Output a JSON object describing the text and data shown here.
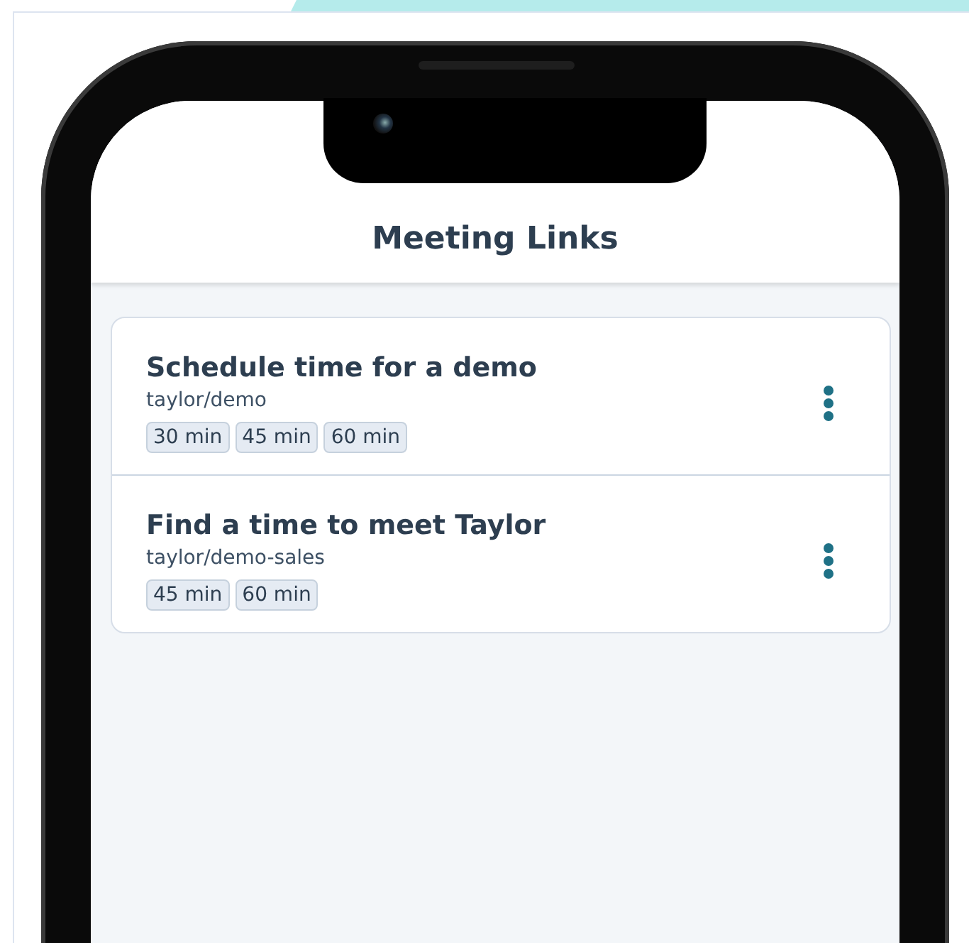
{
  "header": {
    "title": "Meeting Links"
  },
  "links": [
    {
      "title": "Schedule time for a demo",
      "slug": "taylor/demo",
      "durations": [
        "30 min",
        "45 min",
        "60 min"
      ]
    },
    {
      "title": "Find a time to meet Taylor",
      "slug": "taylor/demo-sales",
      "durations": [
        "45 min",
        "60 min"
      ]
    }
  ]
}
